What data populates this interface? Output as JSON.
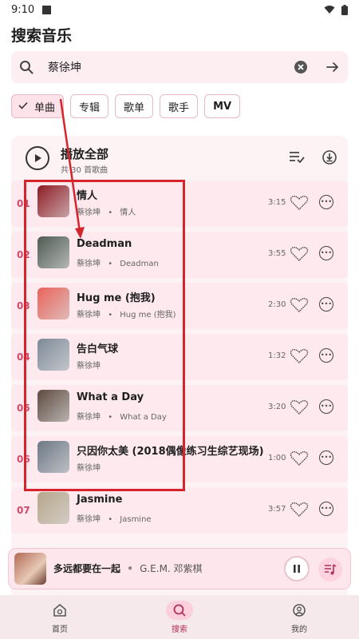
{
  "status": {
    "time": "9:10"
  },
  "page": {
    "title": "搜索音乐"
  },
  "search": {
    "query": "蔡徐坤"
  },
  "filters": [
    {
      "label": "单曲",
      "selected": true
    },
    {
      "label": "专辑",
      "selected": false
    },
    {
      "label": "歌单",
      "selected": false
    },
    {
      "label": "歌手",
      "selected": false
    },
    {
      "label": "MV",
      "selected": false
    }
  ],
  "list": {
    "play_all_label": "播放全部",
    "count_label": "共 30 首歌曲",
    "songs": [
      {
        "num": "01",
        "title": "情人",
        "artist": "蔡徐坤",
        "album": "情人",
        "duration": "3:15",
        "cover_color": "#8e1a22"
      },
      {
        "num": "02",
        "title": "Deadman",
        "artist": "蔡徐坤",
        "album": "Deadman",
        "duration": "3:55",
        "cover_color": "#4d5a52"
      },
      {
        "num": "03",
        "title": "Hug me (抱我)",
        "artist": "蔡徐坤",
        "album": "Hug me (抱我)",
        "duration": "2:30",
        "cover_color": "#e8635a"
      },
      {
        "num": "04",
        "title": "告白气球",
        "artist": "蔡徐坤",
        "album": "",
        "duration": "1:32",
        "cover_color": "#7d8a99"
      },
      {
        "num": "05",
        "title": "What a Day",
        "artist": "蔡徐坤",
        "album": "What a Day",
        "duration": "3:20",
        "cover_color": "#5e4a3f"
      },
      {
        "num": "06",
        "title": "只因你太美 (2018偶像练习生综艺现场)",
        "artist": "蔡徐坤",
        "album": "",
        "duration": "1:00",
        "cover_color": "#6c7885"
      },
      {
        "num": "07",
        "title": "Jasmine",
        "artist": "蔡徐坤",
        "album": "Jasmine",
        "duration": "3:57",
        "cover_color": "#b7a58a"
      }
    ],
    "separator": "•"
  },
  "player": {
    "title": "多远都要在一起",
    "artist": "G.E.M. 邓紫棋",
    "separator": "•"
  },
  "nav": [
    {
      "label": "首页",
      "icon": "home-icon",
      "active": false
    },
    {
      "label": "搜索",
      "icon": "search-icon",
      "active": true
    },
    {
      "label": "我的",
      "icon": "profile-icon",
      "active": false
    }
  ],
  "colors": {
    "accent": "#d24a6a",
    "annotation": "#d6242c",
    "surface": "#fdeef2"
  }
}
